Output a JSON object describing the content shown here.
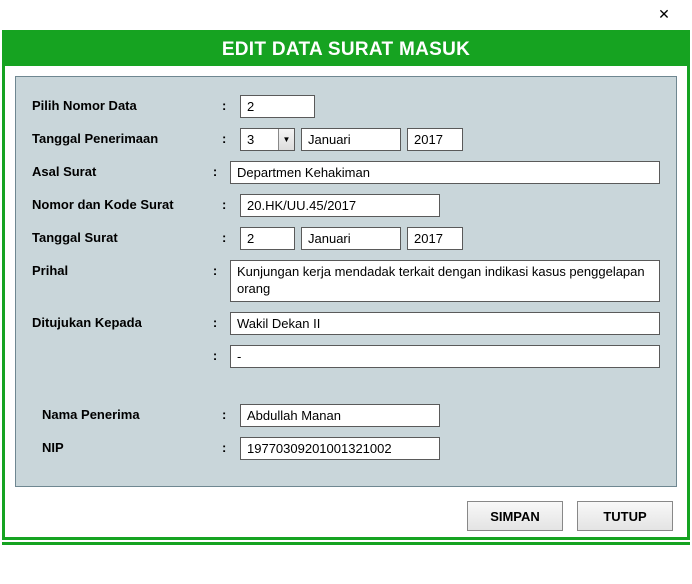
{
  "window": {
    "title": "EDIT DATA SURAT MASUK"
  },
  "labels": {
    "pilih_nomor": "Pilih Nomor Data",
    "tanggal_penerimaan": "Tanggal Penerimaan",
    "asal_surat": "Asal Surat",
    "nomor_kode": "Nomor dan Kode Surat",
    "tanggal_surat": "Tanggal Surat",
    "prihal": "Prihal",
    "ditujukan": "Ditujukan Kepada",
    "nama_penerima": "Nama Penerima",
    "nip": "NIP",
    "colon": ":"
  },
  "fields": {
    "nomor_data": "2",
    "tgl_penerimaan_day": "3",
    "tgl_penerimaan_month": "Januari",
    "tgl_penerimaan_year": "2017",
    "asal_surat": "Departmen Kehakiman",
    "nomor_kode": "20.HK/UU.45/2017",
    "tgl_surat_day": "2",
    "tgl_surat_month": "Januari",
    "tgl_surat_year": "2017",
    "prihal": "Kunjungan kerja mendadak terkait dengan indikasi kasus penggelapan orang",
    "ditujukan": "Wakil Dekan II",
    "ditujukan2": "-",
    "nama_penerima": "Abdullah Manan",
    "nip": "19770309201001321002"
  },
  "buttons": {
    "simpan": "SIMPAN",
    "tutup": "TUTUP"
  }
}
